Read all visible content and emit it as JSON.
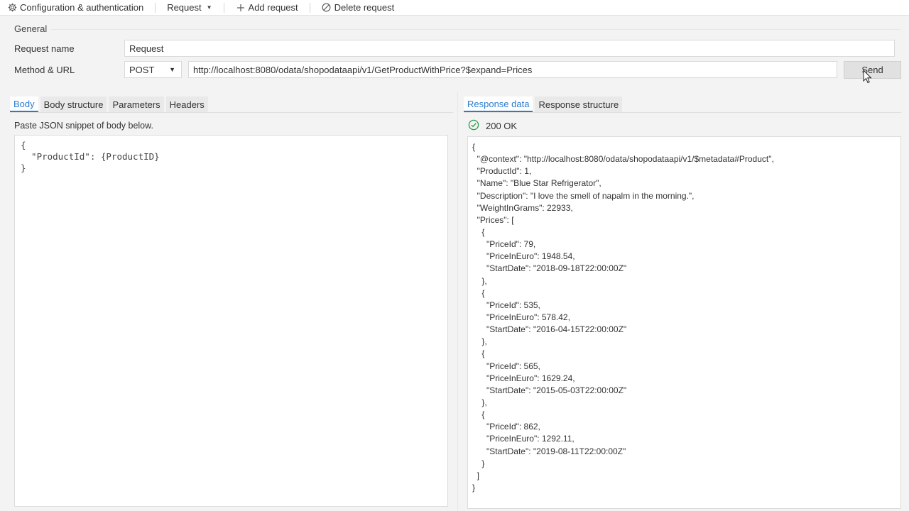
{
  "toolbar": {
    "config_label": "Configuration & authentication",
    "request_label": "Request",
    "add_label": "Add request",
    "delete_label": "Delete request"
  },
  "general": {
    "section_label": "General",
    "request_name_label": "Request name",
    "request_name_value": "Request",
    "method_url_label": "Method & URL",
    "method_value": "POST",
    "url_value": "http://localhost:8080/odata/shopodataapi/v1/GetProductWithPrice?$expand=Prices",
    "send_label": "Send"
  },
  "left_tabs": [
    "Body",
    "Body structure",
    "Parameters",
    "Headers"
  ],
  "body": {
    "hint": "Paste JSON snippet of body below.",
    "lines": [
      "{",
      "  \"ProductId\": {ProductID}",
      "}"
    ]
  },
  "right_tabs": [
    "Response data",
    "Response structure"
  ],
  "response": {
    "status": "200 OK",
    "status_color": "#2e9a4a",
    "lines": [
      "{",
      "  \"@context\": \"http://localhost:8080/odata/shopodataapi/v1/$metadata#Product\",",
      "  \"ProductId\": 1,",
      "  \"Name\": \"Blue Star Refrigerator\",",
      "  \"Description\": \"I love the smell of napalm in the morning.\",",
      "  \"WeightInGrams\": 22933,",
      "  \"Prices\": [",
      "    {",
      "      \"PriceId\": 79,",
      "      \"PriceInEuro\": 1948.54,",
      "      \"StartDate\": \"2018-09-18T22:00:00Z\"",
      "    },",
      "    {",
      "      \"PriceId\": 535,",
      "      \"PriceInEuro\": 578.42,",
      "      \"StartDate\": \"2016-04-15T22:00:00Z\"",
      "    },",
      "    {",
      "      \"PriceId\": 565,",
      "      \"PriceInEuro\": 1629.24,",
      "      \"StartDate\": \"2015-05-03T22:00:00Z\"",
      "    },",
      "    {",
      "      \"PriceId\": 862,",
      "      \"PriceInEuro\": 1292.11,",
      "      \"StartDate\": \"2019-08-11T22:00:00Z\"",
      "    }",
      "  ]",
      "}"
    ]
  },
  "colors": {
    "accent": "#2a7bd0"
  }
}
